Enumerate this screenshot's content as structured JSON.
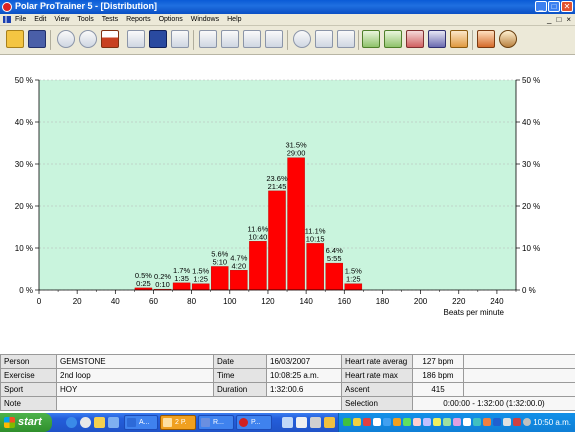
{
  "window": {
    "title": "Polar ProTrainer 5 - [Distribution]",
    "controls": [
      "_",
      "□",
      "✕"
    ]
  },
  "menubar": {
    "items": [
      "File",
      "Edit",
      "View",
      "Tools",
      "Tests",
      "Reports",
      "Options",
      "Windows",
      "Help"
    ],
    "mdi_controls": [
      "_",
      "□",
      "×"
    ]
  },
  "toolbar": {
    "buttons": [
      "open-folder-icon",
      "save-disk-icon",
      "add-exercise-icon",
      "power-icon",
      "weight-icon",
      "calendar-icon",
      "notebook-icon",
      "pen-icon",
      "chart-curve-icon",
      "bar-chart-icon",
      "percent-icon",
      "pie-chart-icon",
      "tools-icon",
      "search-icon",
      "download-icon",
      "upload-icon",
      "zones-icon",
      "zones-2-icon",
      "zones-3-icon",
      "zones-4-icon",
      "zones-5-icon",
      "report-icon",
      "users-icon"
    ]
  },
  "chart_data": {
    "type": "bar",
    "xlabel": "Beats per minute",
    "xlim": [
      0,
      250
    ],
    "xticks": [
      0,
      20,
      40,
      60,
      80,
      100,
      120,
      140,
      160,
      180,
      200,
      220,
      240
    ],
    "ylim": [
      0,
      50
    ],
    "yticks": [
      "0 %",
      "10 %",
      "20 %",
      "30 %",
      "40 %",
      "50 %"
    ],
    "bin_width": 10,
    "grid": "horizontal",
    "background": "#c9f4dd",
    "bar_color": "#ff0000",
    "bars": [
      {
        "x": 50,
        "value": 0.5,
        "pct": "0.5%",
        "time": "0:25"
      },
      {
        "x": 60,
        "value": 0.2,
        "pct": "0.2%",
        "time": "0:10"
      },
      {
        "x": 70,
        "value": 1.7,
        "pct": "1.7%",
        "time": "1:35"
      },
      {
        "x": 80,
        "value": 1.5,
        "pct": "1.5%",
        "time": "1:25"
      },
      {
        "x": 90,
        "value": 5.6,
        "pct": "5.6%",
        "time": "5:10"
      },
      {
        "x": 100,
        "value": 4.7,
        "pct": "4.7%",
        "time": "4:20"
      },
      {
        "x": 110,
        "value": 11.6,
        "pct": "11.6%",
        "time": "10:40"
      },
      {
        "x": 120,
        "value": 23.6,
        "pct": "23.6%",
        "time": "21:45"
      },
      {
        "x": 130,
        "value": 31.5,
        "pct": "31.5%",
        "time": "29:00"
      },
      {
        "x": 140,
        "value": 11.1,
        "pct": "11.1%",
        "time": "10:15"
      },
      {
        "x": 150,
        "value": 6.4,
        "pct": "6.4%",
        "time": "5:55"
      },
      {
        "x": 160,
        "value": 1.5,
        "pct": "1.5%",
        "time": "1:25"
      }
    ]
  },
  "info": {
    "person_label": "Person",
    "person": "GEMSTONE",
    "exercise_label": "Exercise",
    "exercise": "2nd loop",
    "sport_label": "Sport",
    "sport": "HOY",
    "note_label": "Note",
    "date_label": "Date",
    "date": "16/03/2007",
    "time_label": "Time",
    "time": "10:08:25 a.m.",
    "duration_label": "Duration",
    "duration": "1:32:00.6",
    "hr_avg_label": "Heart rate averag",
    "hr_avg": "127 bpm",
    "hr_max_label": "Heart rate max",
    "hr_max": "186 bpm",
    "ascent_label": "Ascent",
    "ascent": "415",
    "selection_label": "Selection",
    "selection": "0:00:00 - 1:32:00 (1:32:00.0)"
  },
  "taskbar": {
    "start": "start",
    "tasks": [
      {
        "label": "A...",
        "color": "#2d6ad8"
      },
      {
        "label": "2 P.",
        "color": "#f0a020"
      },
      {
        "label": "R...",
        "color": "#6a8fe0"
      },
      {
        "label": "P...",
        "color": "#d02020"
      }
    ],
    "clock": "10:50 a.m."
  }
}
